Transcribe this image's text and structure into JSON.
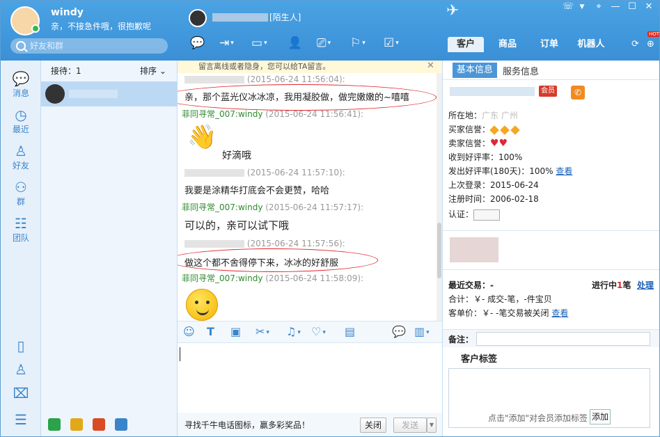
{
  "window": {
    "username": "windy",
    "status_message": "亲，不接急件哦，很抱歉呢",
    "search_placeholder": "好友和群"
  },
  "contact": {
    "tag": "[陌生人]"
  },
  "right_tabs": [
    "客户",
    "商品",
    "订单",
    "机器人"
  ],
  "hot_badge": "HOT",
  "left_nav": [
    "消息",
    "最近",
    "好友",
    "群",
    "团队"
  ],
  "contact_list": {
    "reception": "接待：1",
    "sort": "排序"
  },
  "notice": "留言离线或者隐身，您可以给TA留言。",
  "chat": {
    "messages": [
      {
        "time": "(2015-06-24 11:56:04):",
        "text": "亲，那个蓝光仪冰冰凉，我用凝胶做，做完嫩嫩的~嘻嘻"
      },
      {
        "sender": "菲同寻常_007:windy",
        "time": "(2015-06-24 11:56:41):",
        "text": "好滴哦"
      },
      {
        "time": "(2015-06-24 11:57:10):",
        "text": "我要是涂精华打底会不会更赞，哈哈"
      },
      {
        "sender": "菲同寻常_007:windy",
        "time": "(2015-06-24 11:57:17):",
        "text": "可以的，亲可以试下哦"
      },
      {
        "time": "(2015-06-24 11:57:56):",
        "text": "做这个都不舍得停下来，冰冰的好舒服"
      },
      {
        "sender": "菲同寻常_007:windy",
        "time": "(2015-06-24 11:58:09):",
        "text": ""
      }
    ]
  },
  "bottom": {
    "promo": "寻找千牛电话图标，赢多彩奖品！",
    "close": "关闭",
    "send": "发送"
  },
  "customer": {
    "tab_basic": "基本信息",
    "tab_service": "服务信息",
    "vip": "会员",
    "location_label": "所在地：",
    "location_value": "广东 广州",
    "buyer_credit": "买家信誉：",
    "seller_credit": "卖家信誉：",
    "good_rate_received": "收到好评率：100%",
    "good_rate_given": "发出好评率(180天)：100%",
    "view": "查看",
    "last_login": "上次登录：2015-06-24",
    "register_time": "注册时间：2006-02-18",
    "verify": "认证：",
    "recent_trade": "最近交易：-",
    "in_progress_prefix": "进行中",
    "in_progress_count": "1",
    "in_progress_suffix": "笔",
    "handle": "处理",
    "total": "合计：￥-   成交-笔，-件宝贝",
    "unit_price": "客单价：￥-   -笔交易被关闭",
    "view2": "查看",
    "notes_label": "备注：",
    "tags_title": "客户标签",
    "tags_hint": "点击\"添加\"对会员添加标签",
    "tags_add": "添加"
  }
}
